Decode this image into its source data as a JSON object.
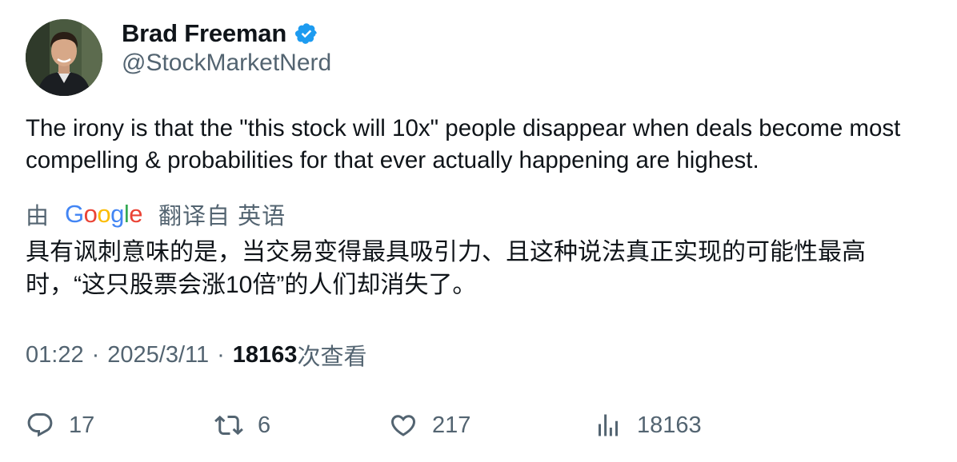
{
  "author": {
    "display_name": "Brad Freeman",
    "handle": "@StockMarketNerd",
    "verified": true,
    "verified_color": "#1d9bf0"
  },
  "tweet": {
    "text": "The irony is that the \"this stock will 10x\" people disappear when deals become most compelling & probabilities for that ever actually happening are highest."
  },
  "translation": {
    "by_label": "由",
    "provider": "Google",
    "from_label": "翻译自 英语",
    "text": "具有讽刺意味的是，当交易变得最具吸引力、且这种说法真正实现的可能性最高时，“这只股票会涨10倍”的人们却消失了。"
  },
  "meta": {
    "time": "01:22",
    "separator": "·",
    "date": "2025/3/11",
    "views_count": "18163",
    "views_label": "次查看"
  },
  "actions": {
    "reply_count": "17",
    "retweet_count": "6",
    "like_count": "217",
    "views_count": "18163"
  },
  "icons": {
    "reply": "reply-icon",
    "retweet": "retweet-icon",
    "like": "heart-icon",
    "views": "analytics-icon",
    "verified": "verified-badge-icon"
  },
  "colors": {
    "text_primary": "#0f1419",
    "text_secondary": "#536471",
    "google_blue": "#4285F4",
    "google_red": "#EA4335",
    "google_yellow": "#FBBC05",
    "google_green": "#34A853"
  }
}
